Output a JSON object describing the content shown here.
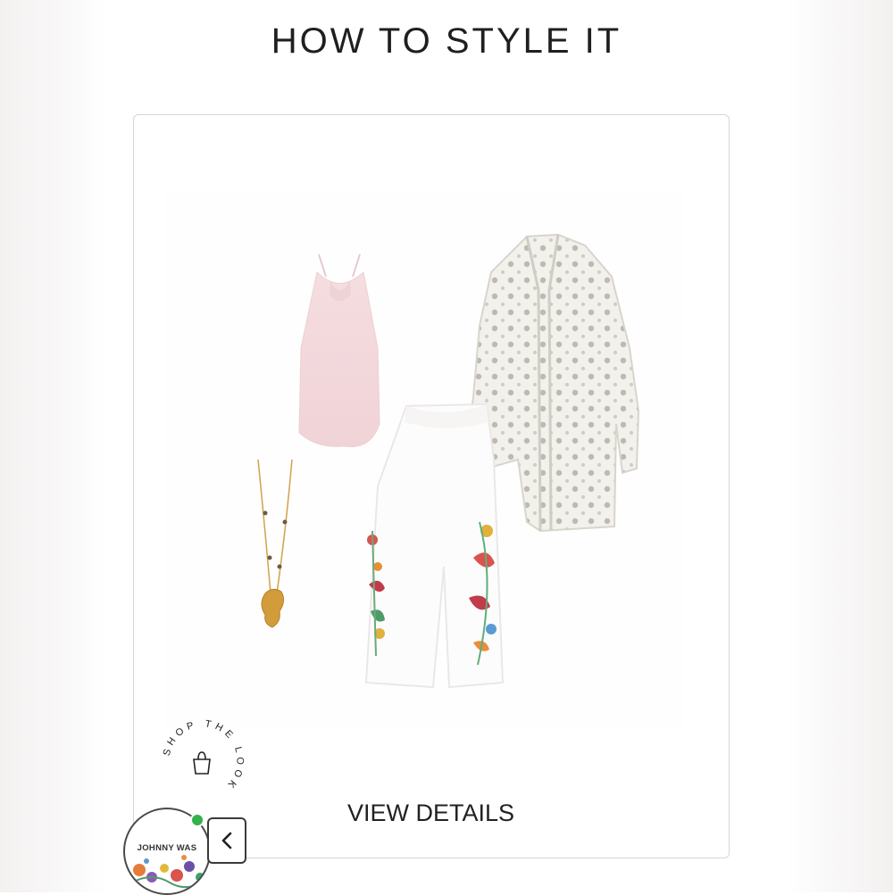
{
  "header": {
    "title": "HOW TO STYLE IT"
  },
  "card": {
    "view_details_label": "VIEW DETAILS",
    "look_items": [
      "pink-cami-top",
      "eyelet-duster-cardigan",
      "embroidered-white-pants",
      "gold-charm-necklace"
    ]
  },
  "shop_the_look": {
    "label": "SHOP THE LOOK",
    "icon": "shopping-bag-icon"
  },
  "brand_badge": {
    "name": "JOHNNY WAS"
  },
  "widget": {
    "collapse_icon": "chevron-left-icon",
    "status": "online",
    "status_color": "#34b24a"
  },
  "colors": {
    "accent_text": "#1f1f1f",
    "card_border": "#d6d6d6"
  }
}
